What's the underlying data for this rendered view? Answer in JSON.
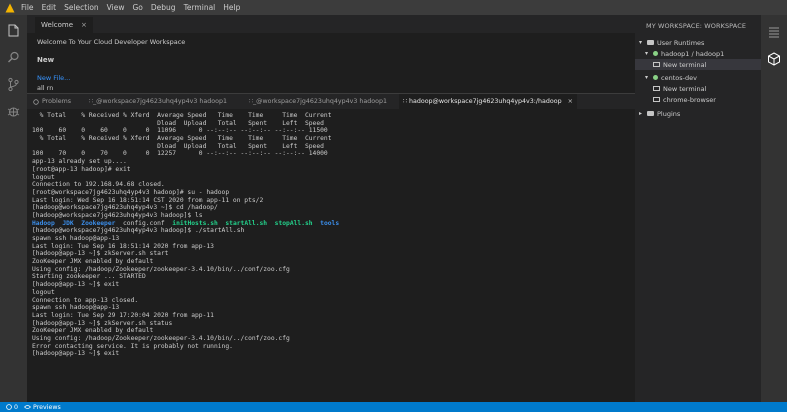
{
  "menubar": {
    "items": [
      "File",
      "Edit",
      "Selection",
      "View",
      "Go",
      "Debug",
      "Terminal",
      "Help"
    ]
  },
  "editor": {
    "tab_label": "Welcome",
    "tab_close": "×",
    "title": "Welcome To Your Cloud Developer Workspace",
    "new_heading": "New",
    "new_file_link": "New File...",
    "line2": "all rn"
  },
  "panel": {
    "tabs": [
      {
        "label": "Problems"
      },
      {
        "label": "∷_@workspace7jg4623uhq4yp4v3 hadoop1"
      },
      {
        "label": "∷_@workspace7jg4623uhq4yp4v3 hadoop1"
      },
      {
        "label": "∷ hadoop@workspace7jg4623uhq4yp4v3:/hadoop"
      }
    ],
    "close": "×"
  },
  "terminal": {
    "lines": [
      [
        {
          "t": "  % Total    % Received % Xferd  Average Speed   Time    Time     Time  Current",
          "c": "plain"
        }
      ],
      [
        {
          "t": "                                 Dload  Upload   Total   Spent    Left  Speed",
          "c": "plain"
        }
      ],
      [
        {
          "t": "100    60    0    60    0     0  11096      0 --:--:-- --:--:-- --:--:-- 11500",
          "c": "plain"
        }
      ],
      [
        {
          "t": "  % Total    % Received % Xferd  Average Speed   Time    Time     Time  Current",
          "c": "plain"
        }
      ],
      [
        {
          "t": "                                 Dload  Upload   Total   Spent    Left  Speed",
          "c": "plain"
        }
      ],
      [
        {
          "t": "100    70    0    70    0     0  12257      0 --:--:-- --:--:-- --:--:-- 14000",
          "c": "plain"
        }
      ],
      [
        {
          "t": "app-13 already set up....",
          "c": "plain"
        }
      ],
      [
        {
          "t": "[root@app-13 hadoop]# exit",
          "c": "plain"
        }
      ],
      [
        {
          "t": "logout",
          "c": "plain"
        }
      ],
      [
        {
          "t": "Connection to 192.168.94.68 closed.",
          "c": "plain"
        }
      ],
      [
        {
          "t": "[root@workspace7jg4623uhq4yp4v3 hadoop]# su - hadoop",
          "c": "plain"
        }
      ],
      [
        {
          "t": "Last login: Wed Sep 16 18:51:14 CST 2020 from app-11 on pts/2",
          "c": "plain"
        }
      ],
      [
        {
          "t": "[hadoop@workspace7jg4623uhq4yp4v3 ~]$ cd /hadoop/",
          "c": "plain"
        }
      ],
      [
        {
          "t": "[hadoop@workspace7jg4623uhq4yp4v3 hadoop]$ ls",
          "c": "plain"
        }
      ],
      [
        {
          "t": "Hadoop  JDK  Zookeeper  ",
          "c": "blue"
        },
        {
          "t": "config.conf  ",
          "c": "plain"
        },
        {
          "t": "initHosts.sh  startAll.sh  stopAll.sh  ",
          "c": "green"
        },
        {
          "t": "tools",
          "c": "blue"
        }
      ],
      [
        {
          "t": "[hadoop@workspace7jg4623uhq4yp4v3 hadoop]$ ./startAll.sh",
          "c": "plain"
        }
      ],
      [
        {
          "t": "spawn ssh hadoop@app-13",
          "c": "plain"
        }
      ],
      [
        {
          "t": "Last login: Tue Sep 16 18:51:14 2020 from app-13",
          "c": "plain"
        }
      ],
      [
        {
          "t": "[hadoop@app-13 ~]$ zkServer.sh start",
          "c": "plain"
        }
      ],
      [
        {
          "t": "ZooKeeper JMX enabled by default",
          "c": "plain"
        }
      ],
      [
        {
          "t": "Using config: /hadoop/Zookeeper/zookeeper-3.4.10/bin/../conf/zoo.cfg",
          "c": "plain"
        }
      ],
      [
        {
          "t": "Starting zookeeper ... STARTED",
          "c": "plain"
        }
      ],
      [
        {
          "t": "[hadoop@app-13 ~]$ exit",
          "c": "plain"
        }
      ],
      [
        {
          "t": "logout",
          "c": "plain"
        }
      ],
      [
        {
          "t": "Connection to app-13 closed.",
          "c": "plain"
        }
      ],
      [
        {
          "t": "spawn ssh hadoop@app-13",
          "c": "plain"
        }
      ],
      [
        {
          "t": "Last login: Tue Sep 29 17:20:04 2020 from app-11",
          "c": "plain"
        }
      ],
      [
        {
          "t": "[hadoop@app-13 ~]$ zkServer.sh status",
          "c": "plain"
        }
      ],
      [
        {
          "t": "ZooKeeper JMX enabled by default",
          "c": "plain"
        }
      ],
      [
        {
          "t": "Using config: /hadoop/Zookeeper/zookeeper-3.4.10/bin/../conf/zoo.cfg",
          "c": "plain"
        }
      ],
      [
        {
          "t": "Error contacting service. It is probably not running.",
          "c": "plain"
        }
      ],
      [
        {
          "t": "[hadoop@app-13 ~]$ exit",
          "c": "plain"
        }
      ]
    ]
  },
  "sidebar": {
    "title": "MY WORKSPACE: WORKSPACE",
    "section": "User Runtimes",
    "runtime1": "hadoop1 / hadoop1",
    "runtime1_terminal": "New terminal",
    "runtime2": "centos-dev",
    "runtime2_terminal": "New terminal",
    "runtime2_browser": "chrome-browser",
    "plugins": "Plugins"
  },
  "statusbar": {
    "count": "0",
    "previews": "Previews"
  },
  "colors": {
    "accent": "#007acc",
    "running_dot": "#89d185",
    "link": "#3794ff"
  }
}
